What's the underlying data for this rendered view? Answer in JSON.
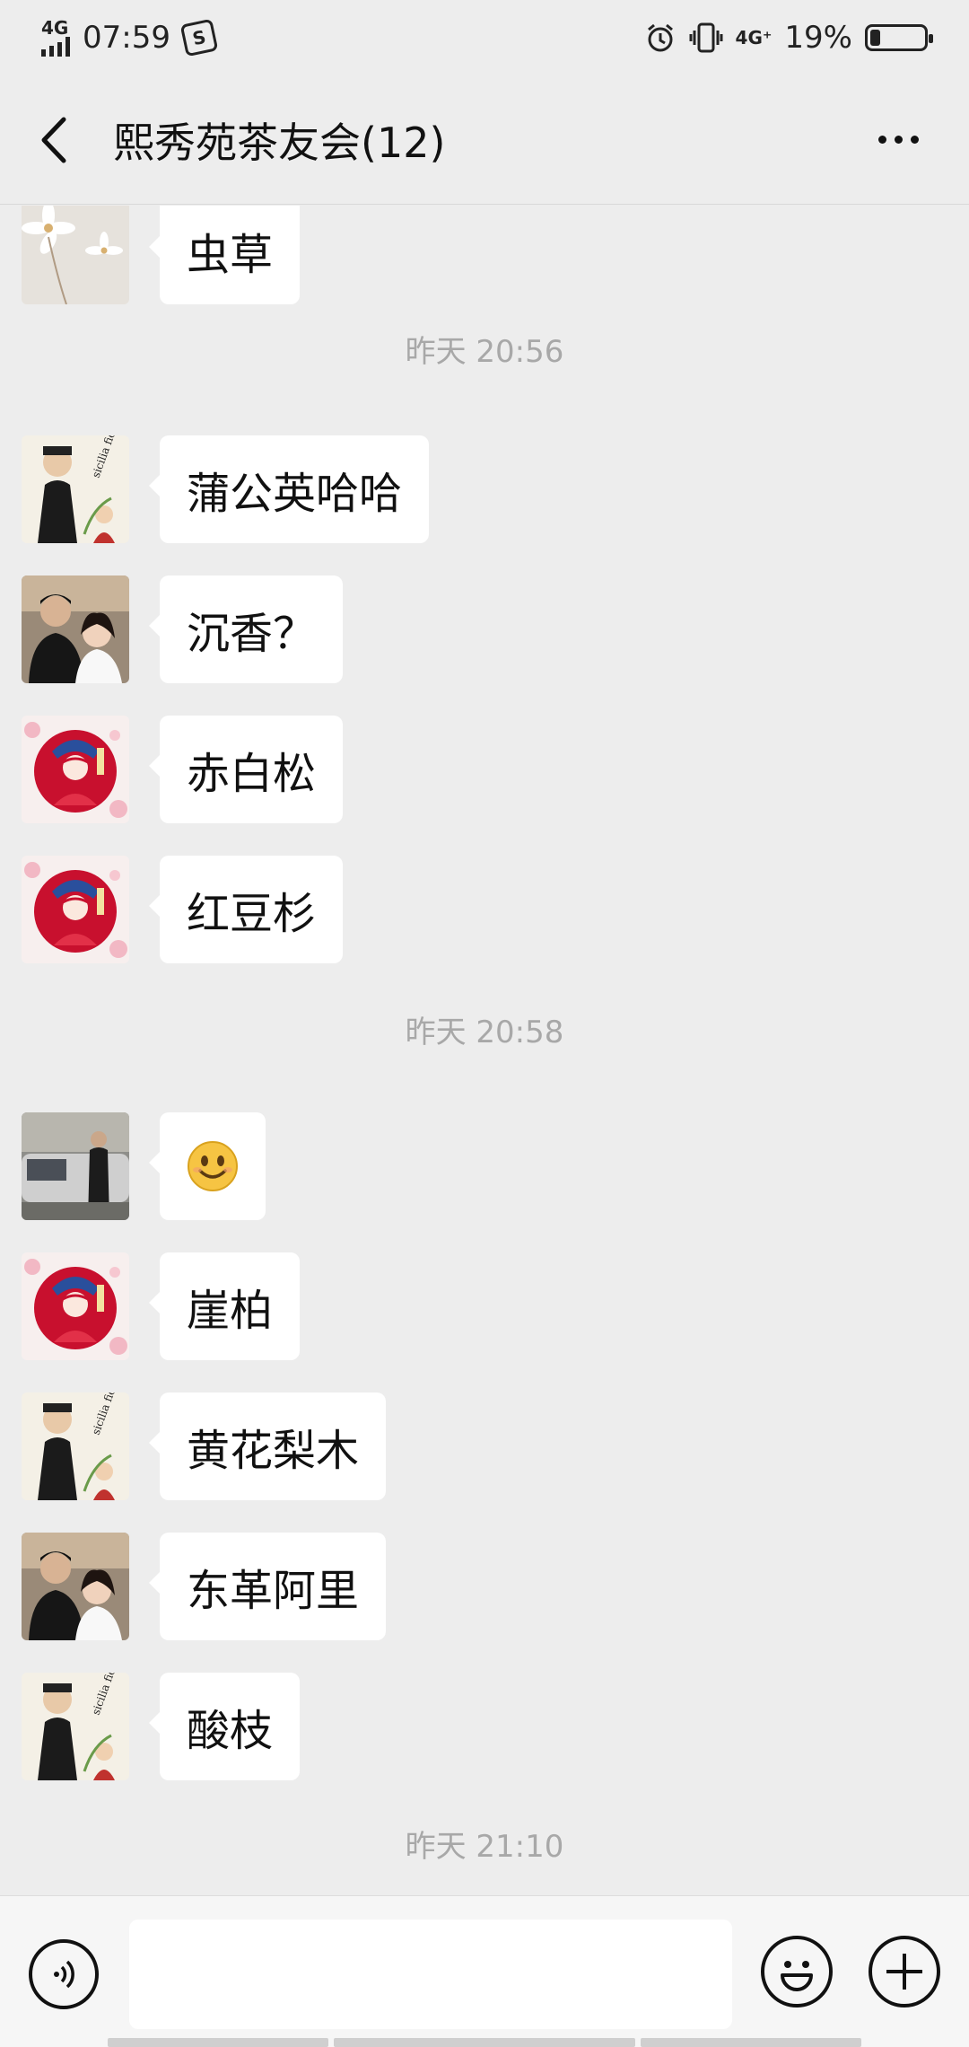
{
  "status_bar": {
    "network_left": "4G",
    "time": "07:59",
    "app_icon": "S",
    "network_right": "4G⁺",
    "battery_percent": "19%",
    "battery_level": 0.19,
    "icons": [
      "signal-icon",
      "sogou-s-icon",
      "alarm-icon",
      "vibrate-icon",
      "battery-icon"
    ]
  },
  "header": {
    "title": "熙秀苑茶友会(12)",
    "icons": [
      "back-arrow-icon",
      "more-icon"
    ]
  },
  "chat": {
    "messages": [
      {
        "type": "text",
        "avatar": "flower",
        "text": "虫草"
      },
      {
        "type": "time",
        "text": "昨天 20:56"
      },
      {
        "type": "text",
        "avatar": "sicilia",
        "text": "蒲公英哈哈"
      },
      {
        "type": "text",
        "avatar": "couple",
        "text": "沉香？"
      },
      {
        "type": "text",
        "avatar": "opera",
        "text": "赤白松"
      },
      {
        "type": "text",
        "avatar": "opera",
        "text": "红豆杉"
      },
      {
        "type": "time",
        "text": "昨天 20:58"
      },
      {
        "type": "emoji",
        "avatar": "man-car",
        "text": "smile-emoji"
      },
      {
        "type": "text",
        "avatar": "opera",
        "text": "崖柏"
      },
      {
        "type": "text",
        "avatar": "sicilia",
        "text": "黄花梨木"
      },
      {
        "type": "text",
        "avatar": "couple",
        "text": "东革阿里"
      },
      {
        "type": "text",
        "avatar": "sicilia",
        "text": "酸枝"
      },
      {
        "type": "time",
        "text": "昨天 21:10"
      }
    ],
    "avatar_text": {
      "sicilia": "sicilia fiori"
    }
  },
  "input_bar": {
    "value": "",
    "icons": [
      "voice-icon",
      "emoji-icon",
      "plus-icon"
    ]
  },
  "colors": {
    "background": "#ededed",
    "bubble": "#ffffff",
    "timestamp": "#a8a8a8",
    "input_bar": "#f6f6f6"
  }
}
